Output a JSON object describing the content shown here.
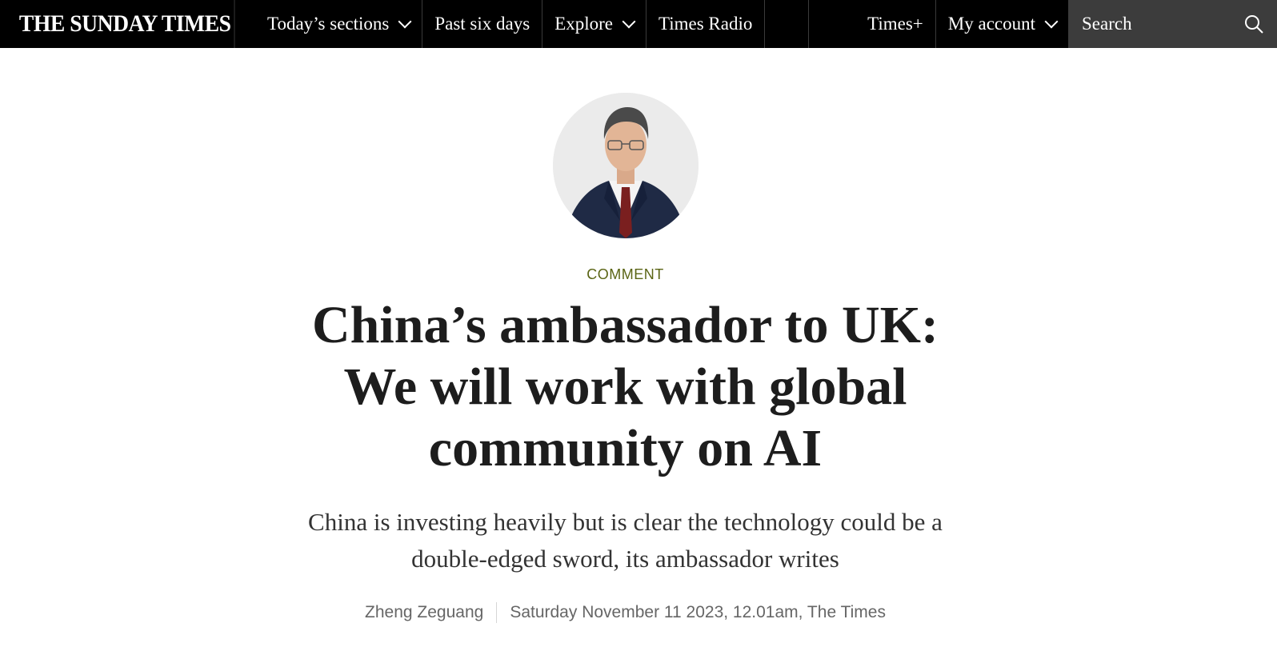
{
  "nav": {
    "logo": "THE SUNDAY TIMES",
    "items": [
      {
        "label": "Today’s sections",
        "dropdown": true
      },
      {
        "label": "Past six days",
        "dropdown": false
      },
      {
        "label": "Explore",
        "dropdown": true
      },
      {
        "label": "Times Radio",
        "dropdown": false
      }
    ],
    "times_plus": "Times+",
    "account": "My account",
    "search_label": "Search"
  },
  "article": {
    "kicker": "COMMENT",
    "headline": "China’s ambassador to UK: We will work with global community on AI",
    "standfirst": "China is investing heavily but is clear the technology could be a double-edged sword, its ambassador writes",
    "author": "Zheng Zeguang",
    "date": "Saturday November 11 2023, 12.01am, The Times"
  },
  "colors": {
    "nav_bg": "#000000",
    "search_bg": "#3c3c3c",
    "kicker": "#5a6414",
    "headline": "#1d1d1d"
  }
}
